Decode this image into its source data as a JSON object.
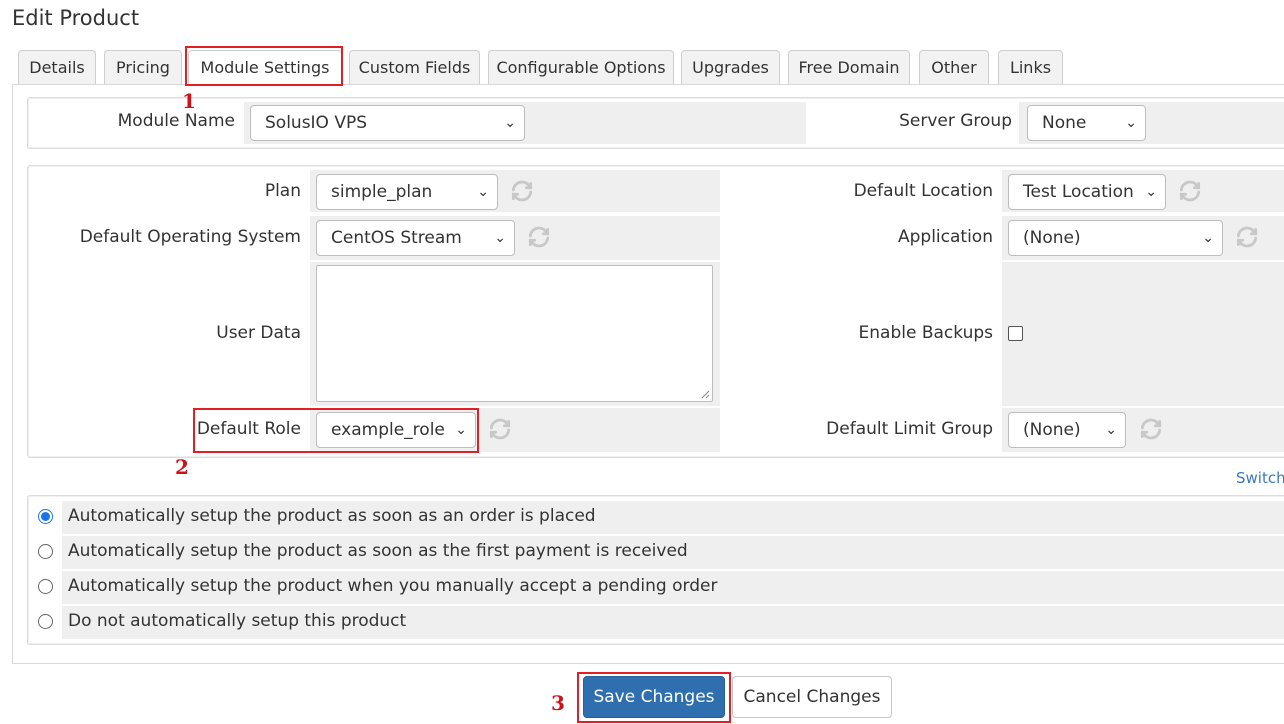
{
  "page": {
    "title": "Edit Product"
  },
  "tabs": [
    {
      "label": "Details"
    },
    {
      "label": "Pricing"
    },
    {
      "label": "Module Settings"
    },
    {
      "label": "Custom Fields"
    },
    {
      "label": "Configurable Options"
    },
    {
      "label": "Upgrades"
    },
    {
      "label": "Free Domain"
    },
    {
      "label": "Other"
    },
    {
      "label": "Links"
    }
  ],
  "module": {
    "name_label": "Module Name",
    "name_value": "SolusIO VPS",
    "server_group_label": "Server Group",
    "server_group_value": "None"
  },
  "settings": {
    "plan_label": "Plan",
    "plan_value": "simple_plan",
    "os_label": "Default Operating System",
    "os_value": "CentOS Stream",
    "user_data_label": "User Data",
    "user_data_value": "",
    "role_label": "Default Role",
    "role_value": "example_role",
    "location_label": "Default Location",
    "location_value": "Test Location",
    "application_label": "Application",
    "application_value": "(None)",
    "backups_label": "Enable Backups",
    "backups_checked": false,
    "limit_group_label": "Default Limit Group",
    "limit_group_value": "(None)"
  },
  "switch_link": "Switch",
  "setup_options": [
    {
      "label": "Automatically setup the product as soon as an order is placed",
      "checked": true
    },
    {
      "label": "Automatically setup the product as soon as the first payment is received",
      "checked": false
    },
    {
      "label": "Automatically setup the product when you manually accept a pending order",
      "checked": false
    },
    {
      "label": "Do not automatically setup this product",
      "checked": false
    }
  ],
  "buttons": {
    "save": "Save Changes",
    "cancel": "Cancel Changes"
  },
  "annotations": {
    "step1": "1",
    "step2": "2",
    "step3": "3"
  },
  "colors": {
    "highlight": "#e31e24",
    "primary": "#2f6fb0",
    "annotation": "#d0111a"
  }
}
